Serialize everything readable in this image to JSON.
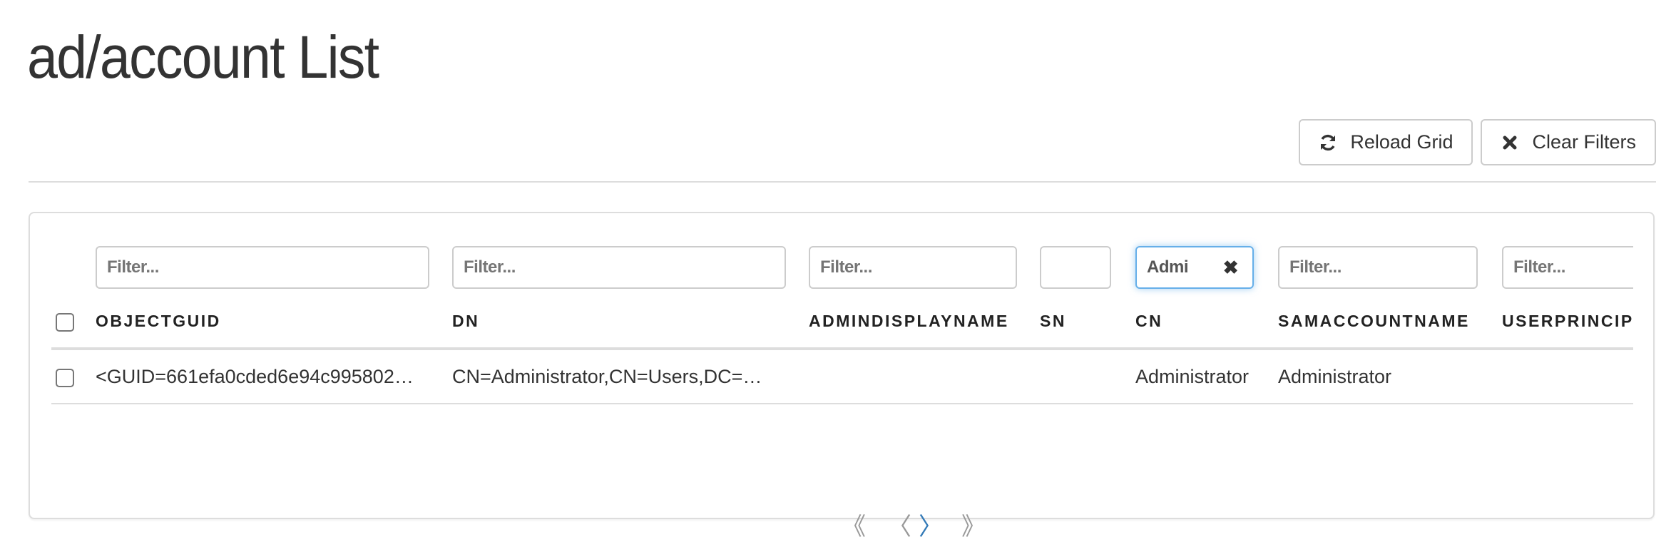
{
  "page": {
    "title": "ad/account List"
  },
  "toolbar": {
    "reload": {
      "label": "Reload Grid",
      "icon": "refresh-icon"
    },
    "clear": {
      "label": "Clear Filters",
      "icon": "times-icon"
    }
  },
  "grid": {
    "columns": [
      {
        "key": "objectguid",
        "header": "OBJECTGUID",
        "filter_value": "",
        "filter_placeholder": "Filter..."
      },
      {
        "key": "dn",
        "header": "DN",
        "filter_value": "",
        "filter_placeholder": "Filter..."
      },
      {
        "key": "admindisplayname",
        "header": "ADMINDISPLAYNAME",
        "filter_value": "",
        "filter_placeholder": "Filter..."
      },
      {
        "key": "sn",
        "header": "SN",
        "filter_value": "",
        "filter_placeholder": ""
      },
      {
        "key": "cn",
        "header": "CN",
        "filter_value": "Admi",
        "filter_placeholder": "Filter..."
      },
      {
        "key": "samaccountname",
        "header": "SAMACCOUNTNAME",
        "filter_value": "",
        "filter_placeholder": "Filter..."
      },
      {
        "key": "userprincipalname",
        "header": "USERPRINCIP",
        "filter_value": "",
        "filter_placeholder": "Filter..."
      }
    ],
    "rows": [
      {
        "objectguid": "<GUID=661efa0cded6e94c995802…",
        "dn": "CN=Administrator,CN=Users,DC=…",
        "admindisplayname": "",
        "sn": "",
        "cn": "Administrator",
        "samaccountname": "Administrator",
        "userprincipalname": ""
      }
    ]
  },
  "pager": {
    "first": "《",
    "prev": "〈",
    "next": "〉",
    "last": "》",
    "active_color": "#337ab7"
  },
  "colors": {
    "focus_border": "#66afe9",
    "link": "#337ab7"
  }
}
